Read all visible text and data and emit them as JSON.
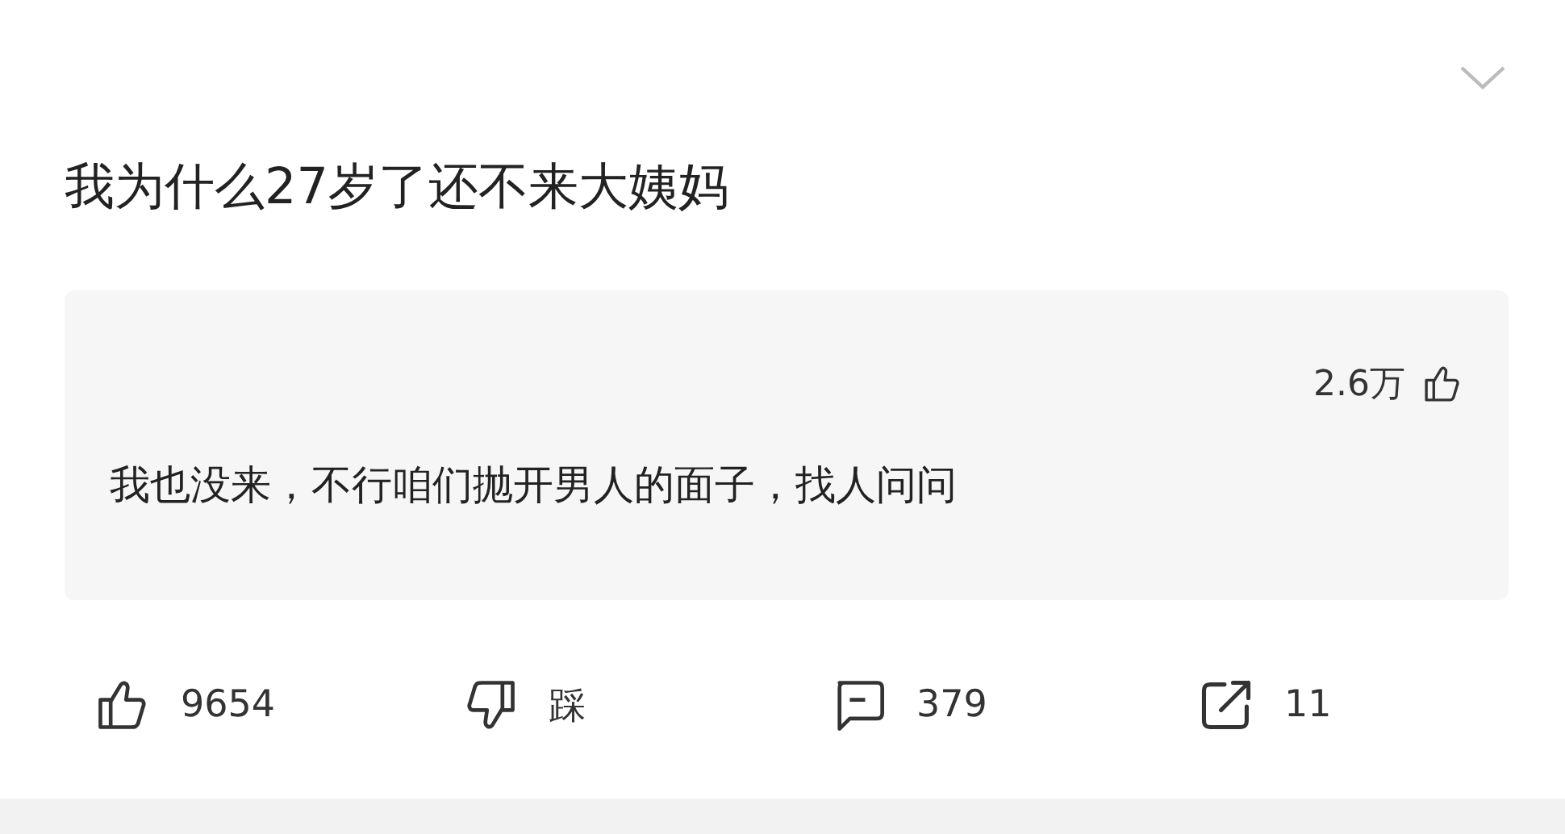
{
  "question": {
    "title": "我为什么27岁了还不来大姨妈"
  },
  "top_comment": {
    "likes": "2.6万",
    "text": "我也没来，不行咱们抛开男人的面子，找人问问"
  },
  "actions": [
    {
      "kind": "like",
      "label": "9654"
    },
    {
      "kind": "dislike",
      "label": "踩"
    },
    {
      "kind": "comment",
      "label": "379"
    },
    {
      "kind": "share",
      "label": "11"
    }
  ]
}
